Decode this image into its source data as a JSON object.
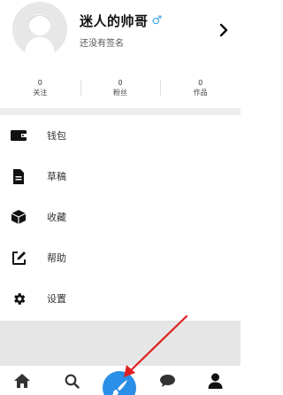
{
  "profile": {
    "name": "迷人的帅哥",
    "gender_symbol": "♂",
    "signature": "还没有签名",
    "avatar_icon": "default-avatar-icon",
    "detail_icon": "chevron-right-icon"
  },
  "stats": [
    {
      "value": "0",
      "label": "关注"
    },
    {
      "value": "0",
      "label": "粉丝"
    },
    {
      "value": "0",
      "label": "作品"
    }
  ],
  "menu": [
    {
      "label": "钱包",
      "icon": "wallet-icon"
    },
    {
      "label": "草稿",
      "icon": "draft-document-icon"
    },
    {
      "label": "收藏",
      "icon": "favorites-box-icon"
    },
    {
      "label": "帮助",
      "icon": "help-edit-icon"
    },
    {
      "label": "设置",
      "icon": "settings-gear-icon"
    }
  ],
  "tabbar": [
    {
      "icon": "home-icon"
    },
    {
      "icon": "search-icon"
    },
    {
      "icon": "brush-create-icon",
      "active": true
    },
    {
      "icon": "message-bubble-icon"
    },
    {
      "icon": "profile-icon"
    }
  ],
  "colors": {
    "accent": "#2a8fe6",
    "gender": "#3aa0e8",
    "annotation_arrow": "#e02020",
    "page_gap": "#ededed"
  }
}
